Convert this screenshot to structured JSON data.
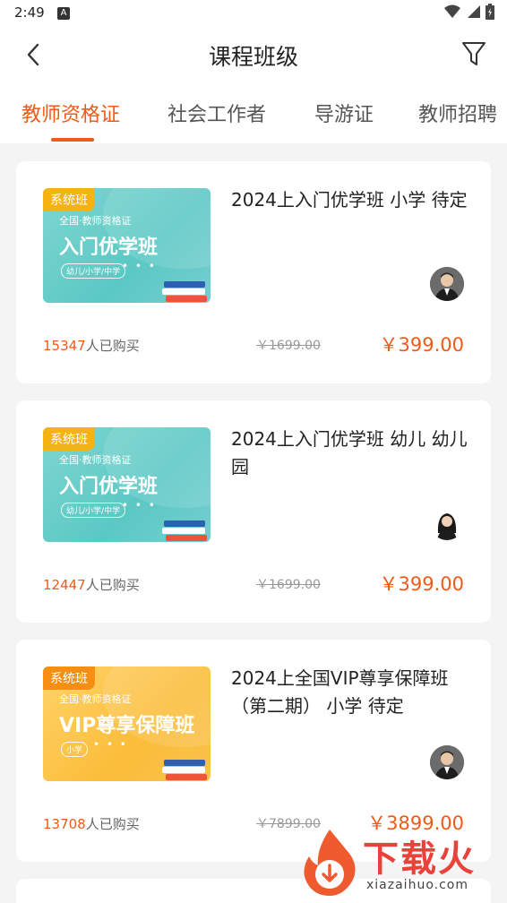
{
  "status": {
    "time": "2:49",
    "badge": "A"
  },
  "header": {
    "title": "课程班级"
  },
  "tabs": [
    {
      "label": "教师资格证",
      "active": true
    },
    {
      "label": "社会工作者",
      "active": false
    },
    {
      "label": "导游证",
      "active": false
    },
    {
      "label": "教师招聘",
      "active": false
    }
  ],
  "cards": [
    {
      "thumb": {
        "tag": "系统班",
        "subtitle": "全国·教师资格证",
        "headline": "入门优学班",
        "pill": "幼儿/小学/中学",
        "dots": "• • •",
        "theme": "teal"
      },
      "title": "2024上入门优学班 小学 待定",
      "buyers_count": "15347",
      "buyers_label": "人已购买",
      "original_price": "￥1699.00",
      "price": "￥399.00",
      "teacher": "male"
    },
    {
      "thumb": {
        "tag": "系统班",
        "subtitle": "全国·教师资格证",
        "headline": "入门优学班",
        "pill": "幼儿/小学/中学",
        "dots": "• • •",
        "theme": "teal"
      },
      "title": "2024上入门优学班 幼儿 幼儿园",
      "buyers_count": "12447",
      "buyers_label": "人已购买",
      "original_price": "￥1699.00",
      "price": "￥399.00",
      "teacher": "female"
    },
    {
      "thumb": {
        "tag": "系统班",
        "subtitle": "全国·教师资格证",
        "headline": "VIP尊享保障班",
        "pill": "小学",
        "dots": "• • •",
        "theme": "gold"
      },
      "title": "2024上全国VIP尊享保障班（第二期） 小学 待定",
      "buyers_count": "13708",
      "buyers_label": "人已购买",
      "original_price": "￥7899.00",
      "price": "￥3899.00",
      "teacher": "male"
    }
  ],
  "watermark": {
    "text": "下载火",
    "url": "xiazaihuo.com"
  },
  "colors": {
    "accent": "#f05a19",
    "tag": "#f5b213",
    "teal": "#5bc8c4",
    "gold": "#fbbd3a"
  },
  "icons": [
    "back-arrow-icon",
    "filter-icon",
    "wifi-icon",
    "signal-icon",
    "battery-icon"
  ]
}
